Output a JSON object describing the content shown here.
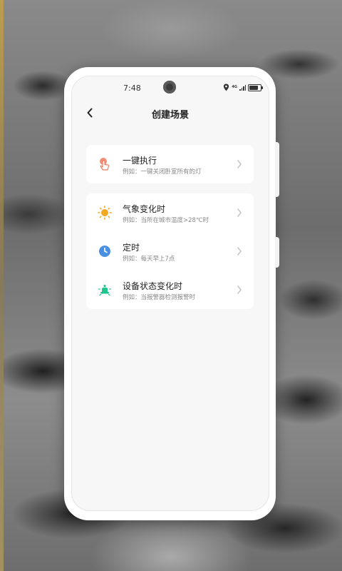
{
  "status_bar": {
    "time": "7:48",
    "network": "4G",
    "battery_level": 0.7
  },
  "header": {
    "title": "创建场景"
  },
  "manual_section": [
    {
      "title": "一键执行",
      "subtitle": "例如：一键关闭卧室所有的灯",
      "icon": "tap-hand-icon"
    }
  ],
  "auto_section": [
    {
      "title": "气象变化时",
      "subtitle": "例如：当所在城市温度>28℃时",
      "icon": "sun-icon"
    },
    {
      "title": "定时",
      "subtitle": "例如：每天早上7点",
      "icon": "clock-icon"
    },
    {
      "title": "设备状态变化时",
      "subtitle": "例如：当报警器检测报警时",
      "icon": "alarm-device-icon"
    }
  ],
  "colors": {
    "tap": "#f07b5e",
    "sun": "#f5a623",
    "clock": "#4a90e2",
    "device": "#1fc58e"
  }
}
